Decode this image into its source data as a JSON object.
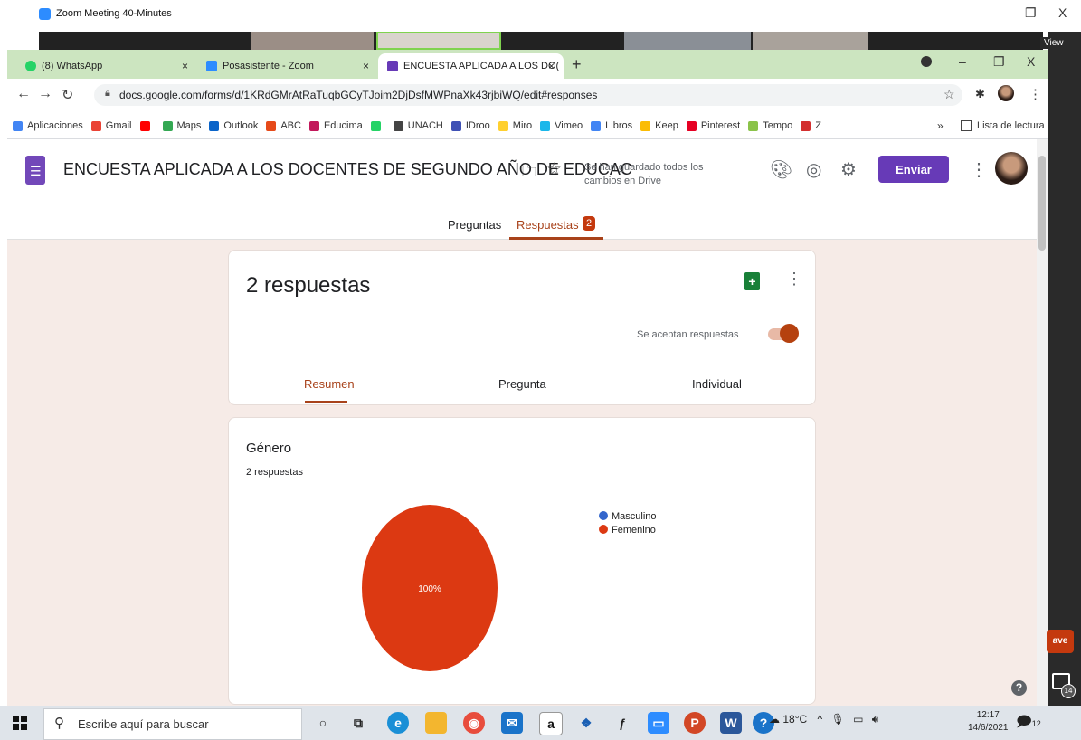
{
  "zoom": {
    "title": "Zoom Meeting 40-Minutes",
    "view_label": "View",
    "min": "–",
    "max": "❐",
    "close": "X"
  },
  "browser": {
    "tabs": [
      {
        "label": "(8) WhatsApp",
        "color": "#25d366"
      },
      {
        "label": "Posasistente - Zoom",
        "color": "#2d8cff"
      },
      {
        "label": "ENCUESTA APLICADA A LOS DO(",
        "color": "#673ab7"
      }
    ],
    "tab_close": "×",
    "new_tab": "+",
    "url": "docs.google.com/forms/d/1KRdGMrAtRaTuqbGCyTJoim2DjDsfMWPnaXk43rjbiWQ/edit#responses",
    "bookmarks": [
      {
        "label": "Aplicaciones",
        "color": "#4285f4"
      },
      {
        "label": "Gmail",
        "color": "#ea4335"
      },
      {
        "label": "",
        "color": "#ff0000"
      },
      {
        "label": "Maps",
        "color": "#34a853"
      },
      {
        "label": "Outlook",
        "color": "#0a64c9"
      },
      {
        "label": "ABC",
        "color": "#e64a19"
      },
      {
        "label": "Educima",
        "color": "#c2185b"
      },
      {
        "label": "",
        "color": "#25d366"
      },
      {
        "label": "UNACH",
        "color": "#444444"
      },
      {
        "label": "IDroo",
        "color": "#3f51b5"
      },
      {
        "label": "Miro",
        "color": "#ffd02f"
      },
      {
        "label": "Vimeo",
        "color": "#1ab7ea"
      },
      {
        "label": "Libros",
        "color": "#4285f4"
      },
      {
        "label": "Keep",
        "color": "#fbbc04"
      },
      {
        "label": "Pinterest",
        "color": "#e60023"
      },
      {
        "label": "Tempo",
        "color": "#8bc34a"
      },
      {
        "label": "Z",
        "color": "#d32f2f"
      }
    ],
    "more_bookmarks": "»",
    "reading_list": "Lista de lectura"
  },
  "form": {
    "title": "ENCUESTA APLICADA A LOS DOCENTES DE SEGUNDO AÑO DE EDUCAC",
    "saved_status": "Se han guardado todos los cambios en Drive",
    "send_label": "Enviar",
    "tab_questions": "Preguntas",
    "tab_responses": "Respuestas",
    "responses_badge": "2",
    "response_count_title": "2 respuestas",
    "accepting_label": "Se aceptan respuestas",
    "subtabs": [
      "Resumen",
      "Pregunta",
      "Individual"
    ],
    "question": {
      "title": "Género",
      "count": "2 respuestas"
    }
  },
  "chart_data": {
    "type": "pie",
    "labels": [
      "Masculino",
      "Femenino"
    ],
    "values": [
      0,
      100
    ],
    "colors": [
      "#3366cc",
      "#dc3912"
    ],
    "slice_labels": [
      "",
      "100%"
    ],
    "legend_position": "right"
  },
  "side": {
    "save_chip": "ave",
    "chat_count": "14",
    "help": "?"
  },
  "taskbar": {
    "search_placeholder": "Escribe aquí para buscar",
    "weather": "18°C",
    "time": "12:17",
    "date": "14/6/2021",
    "notifications": "12"
  }
}
